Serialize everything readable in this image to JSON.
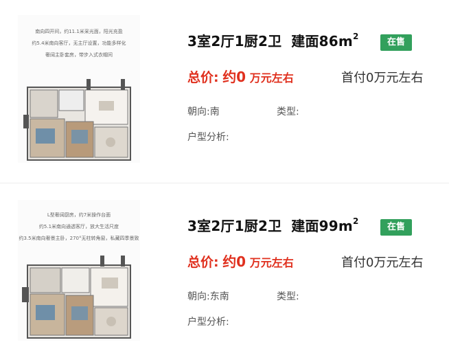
{
  "listings": [
    {
      "image_notes": [
        "南向四开间，约11.1米采光面，阳光充盈",
        "约5.4米南向客厅，无主厅设置，功能多样化",
        "奢阔主卧套房，带步入式衣帽间"
      ],
      "image_top_note": "",
      "title": "3室2厅1厨2卫",
      "area_label": "建面86m",
      "area_sup": "2",
      "status": "在售",
      "price_label": "总价:",
      "price_value": "约0",
      "price_unit": "万元左右",
      "down_payment": "首付0万元左右",
      "orientation_label": "朝向:",
      "orientation_value": "南",
      "type_label": "类型:",
      "type_value": "",
      "analysis_label": "户型分析:",
      "analysis_value": ""
    },
    {
      "image_notes": [
        "L型奢阔厨房，约7米操作台面",
        "约5.1米南向通透客厅，放大生活尺度",
        "约3.5米南向奢景主卧，270°无柱转角窗，私藏四季景致"
      ],
      "title": "3室2厅1厨2卫",
      "area_label": "建面99m",
      "area_sup": "2",
      "status": "在售",
      "price_label": "总价:",
      "price_value": "约0",
      "price_unit": "万元左右",
      "down_payment": "首付0万元左右",
      "orientation_label": "朝向:",
      "orientation_value": "东南",
      "type_label": "类型:",
      "type_value": "",
      "analysis_label": "户型分析:",
      "analysis_value": ""
    }
  ],
  "colors": {
    "status_green": "#32a05c",
    "price_red": "#e0301e"
  }
}
